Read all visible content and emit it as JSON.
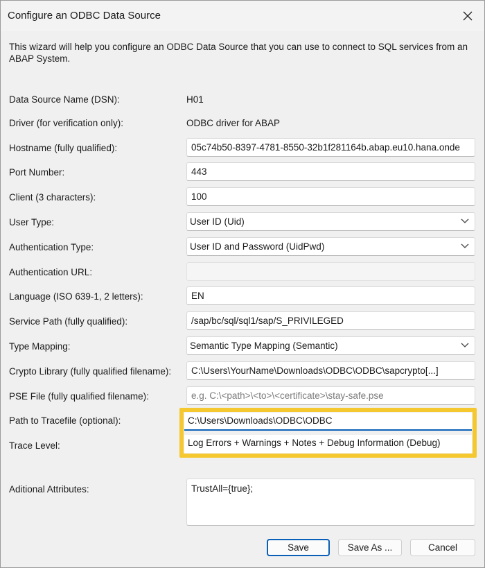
{
  "window": {
    "title": "Configure an ODBC Data Source"
  },
  "intro_text": "This wizard will help you configure an ODBC Data Source that you can use to connect to SQL services from an ABAP System.",
  "fields": {
    "dsn": {
      "label": "Data Source Name (DSN):",
      "value": "H01"
    },
    "driver": {
      "label": "Driver (for verification only):",
      "value": "ODBC driver for ABAP"
    },
    "hostname": {
      "label": "Hostname (fully qualified):",
      "value": "05c74b50-8397-4781-8550-32b1f281164b.abap.eu10.hana.onde"
    },
    "port": {
      "label": "Port Number:",
      "value": "443"
    },
    "client": {
      "label": "Client (3 characters):",
      "value": "100"
    },
    "user_type": {
      "label": "User Type:",
      "value": "User ID (Uid)"
    },
    "auth_type": {
      "label": "Authentication Type:",
      "value": "User ID and Password (UidPwd)"
    },
    "auth_url": {
      "label": "Authentication URL:",
      "value": ""
    },
    "language": {
      "label": "Language (ISO 639-1, 2 letters):",
      "value": "EN"
    },
    "service_path": {
      "label": "Service Path (fully qualified):",
      "value": "/sap/bc/sql/sql1/sap/S_PRIVILEGED"
    },
    "type_mapping": {
      "label": "Type Mapping:",
      "value": "Semantic Type Mapping (Semantic)"
    },
    "crypto_lib": {
      "label": "Crypto Library (fully qualified filename):",
      "value": "C:\\Users\\YourName\\Downloads\\ODBC\\ODBC\\sapcrypto[...]"
    },
    "pse_file": {
      "label": "PSE File (fully qualified filename):",
      "placeholder": "e.g.  C:\\<path>\\<to>\\<certificate>\\stay-safe.pse"
    },
    "trace_path": {
      "label": "Path to Tracefile (optional):",
      "value": "C:\\Users\\Downloads\\ODBC\\ODBC"
    },
    "trace_level": {
      "label": "Trace Level:",
      "value": "Log Errors + Warnings + Notes + Debug Information (Debug)"
    },
    "additional": {
      "label": "Aditional Attributes:",
      "value": "TrustAll={true};"
    }
  },
  "buttons": {
    "save": "Save",
    "save_as": "Save As ...",
    "cancel": "Cancel"
  },
  "icons": {
    "close": "close-icon",
    "dropdown": "chevron-down-icon"
  },
  "colors": {
    "highlight": "#f5c830",
    "focus": "#0a5fb8"
  }
}
